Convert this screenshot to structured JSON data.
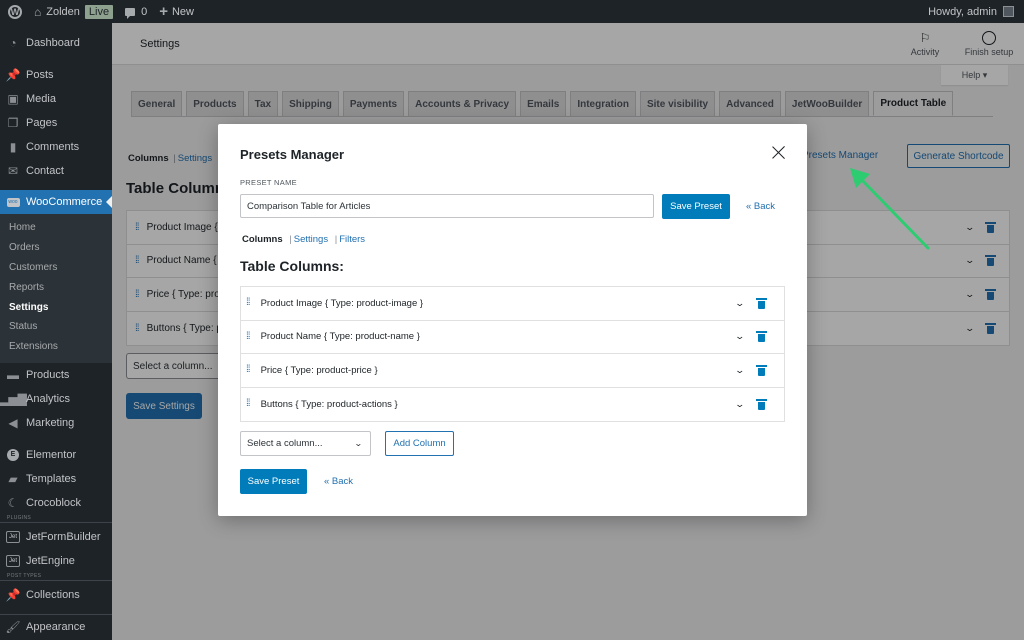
{
  "adminbar": {
    "site_name": "Zolden",
    "live_badge": "Live",
    "comments_count": "0",
    "new_label": "New",
    "howdy": "Howdy, admin"
  },
  "sidebar": {
    "top_items": [
      {
        "label": "Dashboard",
        "icon": "dashboard-icon"
      },
      {
        "label": "Posts",
        "icon": "pin-icon"
      },
      {
        "label": "Media",
        "icon": "media-icon"
      },
      {
        "label": "Pages",
        "icon": "pages-icon"
      },
      {
        "label": "Comments",
        "icon": "comment-icon"
      },
      {
        "label": "Contact",
        "icon": "mail-icon"
      },
      {
        "label": "WooCommerce",
        "icon": "woo-icon"
      }
    ],
    "woo_submenu": [
      "Home",
      "Orders",
      "Customers",
      "Reports",
      "Settings",
      "Status",
      "Extensions"
    ],
    "woo_current": "Settings",
    "mid_items": [
      {
        "label": "Products",
        "icon": "archive-icon"
      },
      {
        "label": "Analytics",
        "icon": "bar-chart-icon"
      },
      {
        "label": "Marketing",
        "icon": "megaphone-icon"
      },
      {
        "label": "Elementor",
        "icon": "elementor-icon"
      },
      {
        "label": "Templates",
        "icon": "folder-icon"
      },
      {
        "label": "Crocoblock",
        "icon": "crocoblock-icon"
      }
    ],
    "plugins_label": "PLUGINS",
    "plugin_items": [
      {
        "label": "JetFormBuilder",
        "icon": "jet-icon"
      },
      {
        "label": "JetEngine",
        "icon": "jet-icon"
      }
    ],
    "post_types_label": "POST TYPES",
    "bottom_items": [
      {
        "label": "Collections",
        "icon": "pin-icon"
      },
      {
        "label": "Appearance",
        "icon": "brush-icon"
      }
    ]
  },
  "header": {
    "title": "Settings",
    "activity_label": "Activity",
    "finish_setup_label": "Finish setup",
    "help_label": "Help ▾"
  },
  "tabs": [
    "General",
    "Products",
    "Tax",
    "Shipping",
    "Payments",
    "Accounts & Privacy",
    "Emails",
    "Integration",
    "Site visibility",
    "Advanced",
    "JetWooBuilder",
    "Product Table"
  ],
  "active_tab": "Product Table",
  "background": {
    "subnav": {
      "current": "Columns",
      "links": [
        "Settings"
      ]
    },
    "heading": "Table Columns:",
    "presets_manager_link": "Presets Manager",
    "generate_shortcode": "Generate Shortcode",
    "rows": [
      "Product Image { Type: product-image }",
      "Product Name { Type: product-name }",
      "Price { Type: product-price }",
      "Buttons { Type: product-actions }"
    ],
    "select_placeholder": "Select a column...",
    "save_settings": "Save Settings"
  },
  "modal": {
    "title": "Presets Manager",
    "preset_name_label": "PRESET NAME",
    "preset_name_value": "Comparison Table for Articles",
    "save_preset": "Save Preset",
    "back": "« Back",
    "nav": {
      "current": "Columns",
      "settings": "Settings",
      "filters": "Filters"
    },
    "heading": "Table Columns:",
    "columns": [
      {
        "label": "Product Image { Type: product-image }"
      },
      {
        "label": "Product Name { Type: product-name }"
      },
      {
        "label": "Price { Type: product-price }"
      },
      {
        "label": "Buttons { Type: product-actions }"
      }
    ],
    "select_placeholder": "Select a column...",
    "add_column": "Add Column"
  },
  "colors": {
    "primary": "#007cba",
    "link": "#2271b1",
    "annotation_arrow": "#2ecc71"
  }
}
